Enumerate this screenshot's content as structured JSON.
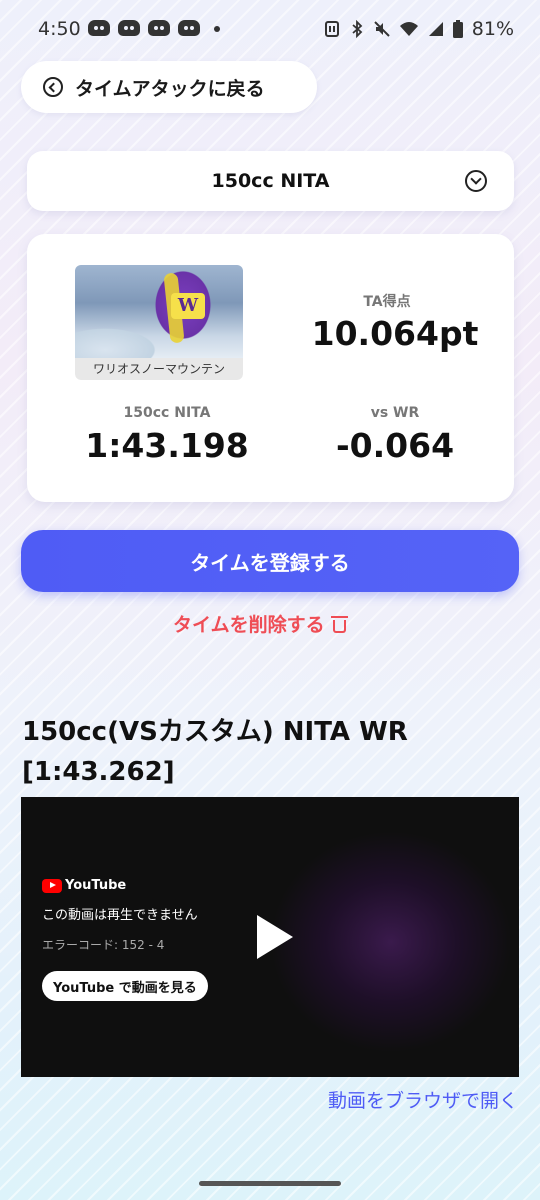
{
  "status_bar": {
    "time": "4:50",
    "battery": "81%"
  },
  "back_button": {
    "label": "タイムアタックに戻る"
  },
  "category_select": {
    "selected": "150cc NITA"
  },
  "record": {
    "course_name": "ワリオスノーマウンテン",
    "ta_label": "TA得点",
    "ta_value": "10.064pt",
    "time_label": "150cc NITA",
    "time_value": "1:43.198",
    "vs_label": "vs WR",
    "vs_value": "-0.064"
  },
  "actions": {
    "register_label": "タイムを登録する",
    "delete_label": "タイムを削除する"
  },
  "wr": {
    "title_line1": "150cc(VSカスタム) NITA WR",
    "title_line2": "[1:43.262]"
  },
  "video": {
    "brand": "YouTube",
    "error_message": "この動画は再生できません",
    "error_code": "エラーコード: 152 - 4",
    "watch_label": "YouTube で動画を見る",
    "open_browser_label": "動画をブラウザで開く"
  },
  "colors": {
    "accent": "#4f5cf5",
    "danger": "#ef4d55"
  }
}
